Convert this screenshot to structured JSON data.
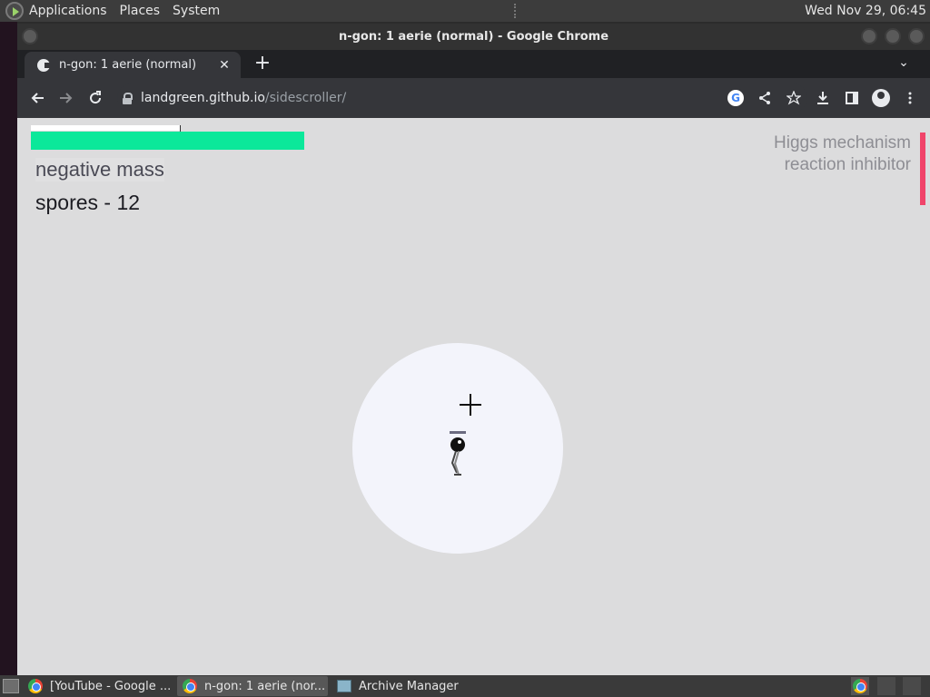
{
  "top_panel": {
    "menus": [
      "Applications",
      "Places",
      "System"
    ],
    "clock": "Wed Nov 29, 06:45"
  },
  "window": {
    "title": "n-gon: 1 aerie (normal) - Google Chrome"
  },
  "tab": {
    "title": "n-gon: 1 aerie (normal)",
    "close": "✕",
    "new_tab": "+",
    "menu": "⌄"
  },
  "toolbar": {
    "url_host": "landgreen.github.io",
    "url_path": "/sidescroller/"
  },
  "game": {
    "field": "negative mass",
    "tech": "spores - 12",
    "mod_line1": "Higgs mechanism",
    "mod_line2": "reaction inhibitor",
    "health_fraction": 1.0,
    "energy_fraction": 0.55
  },
  "colors": {
    "health": "#0be89a",
    "mod_accent": "#f0456a",
    "page_bg": "#dcdcdd"
  },
  "taskbar": {
    "items": [
      {
        "label": "[YouTube - Google ..."
      },
      {
        "label": "n-gon: 1 aerie (nor..."
      },
      {
        "label": "Archive Manager"
      }
    ]
  }
}
